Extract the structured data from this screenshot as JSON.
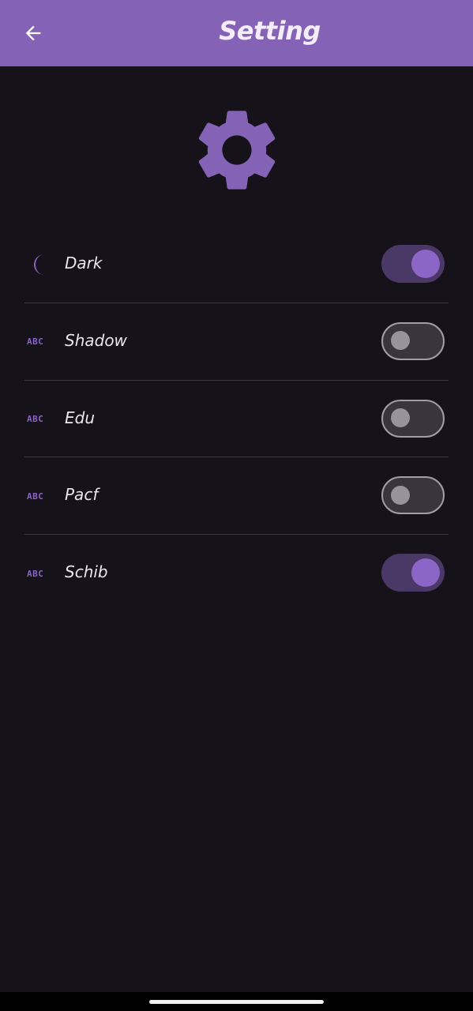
{
  "appbar": {
    "title": "Setting",
    "back_icon": "arrow-back-icon",
    "color": "#8462b5"
  },
  "header_icon": "gear-icon",
  "settings": [
    {
      "icon": "moon-icon",
      "label": "Dark",
      "enabled": true
    },
    {
      "icon": "abc-icon",
      "icon_text": "ABC",
      "label": "Shadow",
      "enabled": false
    },
    {
      "icon": "abc-icon",
      "icon_text": "ABC",
      "label": "Edu",
      "enabled": false
    },
    {
      "icon": "abc-icon",
      "icon_text": "ABC",
      "label": "Pacf",
      "enabled": false
    },
    {
      "icon": "abc-icon",
      "icon_text": "ABC",
      "label": "Schib",
      "enabled": true
    }
  ],
  "colors": {
    "accent": "#8c66c6",
    "background": "#15121a",
    "switch_track_on": "#4a3867",
    "switch_track_off": "#38363c"
  }
}
